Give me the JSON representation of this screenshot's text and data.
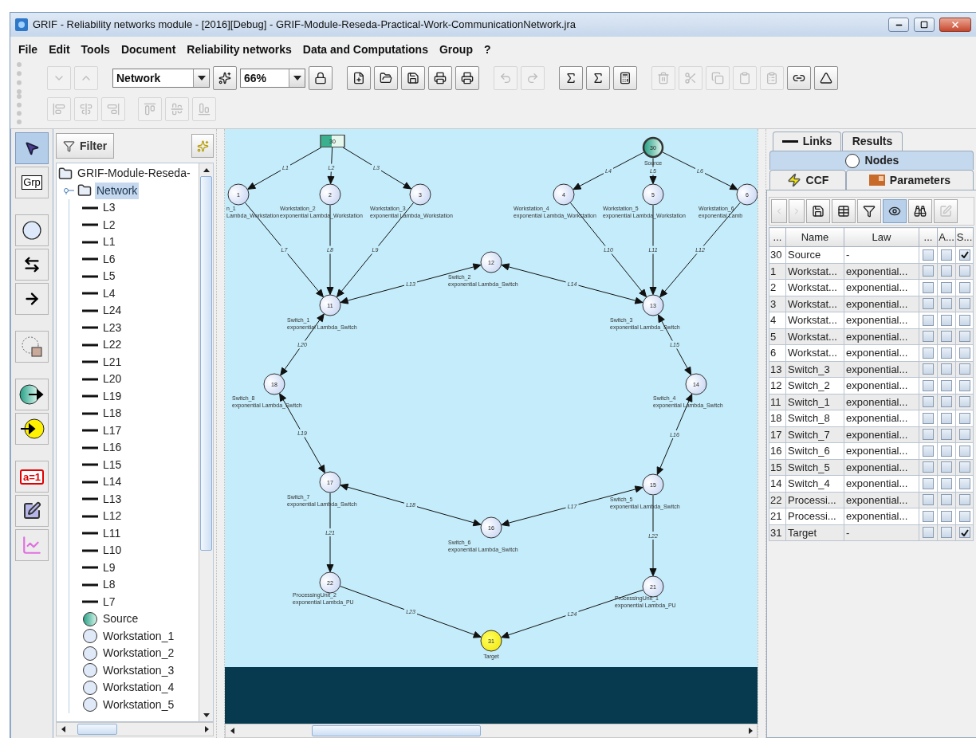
{
  "window": {
    "title": "GRIF - Reliability networks module - [2016][Debug] - GRIF-Module-Reseda-Practical-Work-CommunicationNetwork.jra"
  },
  "menu": [
    "File",
    "Edit",
    "Tools",
    "Document",
    "Reliability networks",
    "Data and Computations",
    "Group",
    "?"
  ],
  "toolbar": {
    "network_select": {
      "value": "Network"
    },
    "zoom_select": {
      "value": "66%"
    },
    "buttons": [
      {
        "disabled": true
      },
      {
        "disabled": true
      },
      {
        "disabled": false
      },
      {
        "disabled": false
      },
      {
        "disabled": false
      },
      {
        "disabled": false
      },
      {
        "disabled": false
      },
      {
        "disabled": false
      },
      {
        "disabled": false
      },
      {
        "disabled": true
      },
      {
        "disabled": true
      },
      {
        "disabled": false
      },
      {
        "disabled": false
      },
      {
        "disabled": false
      },
      {
        "disabled": true
      },
      {
        "disabled": true
      },
      {
        "disabled": true
      },
      {
        "disabled": true
      },
      {
        "disabled": true
      },
      {
        "disabled": false
      },
      {
        "disabled": false
      }
    ],
    "align_buttons": [
      {
        "disabled": true
      },
      {
        "disabled": true
      },
      {
        "disabled": true
      },
      {
        "disabled": true
      },
      {
        "disabled": true
      },
      {
        "disabled": true
      }
    ]
  },
  "tool_palette": [
    {
      "selected": true
    },
    {
      "label": "Grp",
      "selected": false
    },
    {
      "selected": false
    },
    {
      "selected": false
    },
    {
      "selected": false
    },
    {
      "selected": false
    },
    {
      "selected": false
    },
    {
      "selected": false
    },
    {
      "label": "a=1",
      "selected": false
    },
    {
      "selected": false
    },
    {
      "selected": false
    }
  ],
  "tree": {
    "filter_button": "Filter",
    "root": {
      "label": "GRIF-Module-Reseda-",
      "children": [
        {
          "label": "Network",
          "selected": true,
          "expanded": true,
          "children": [
            {
              "label": "L3",
              "kind": "link"
            },
            {
              "label": "L2",
              "kind": "link"
            },
            {
              "label": "L1",
              "kind": "link"
            },
            {
              "label": "L6",
              "kind": "link"
            },
            {
              "label": "L5",
              "kind": "link"
            },
            {
              "label": "L4",
              "kind": "link"
            },
            {
              "label": "L24",
              "kind": "link"
            },
            {
              "label": "L23",
              "kind": "link"
            },
            {
              "label": "L22",
              "kind": "link"
            },
            {
              "label": "L21",
              "kind": "link"
            },
            {
              "label": "L20",
              "kind": "link"
            },
            {
              "label": "L19",
              "kind": "link"
            },
            {
              "label": "L18",
              "kind": "link"
            },
            {
              "label": "L17",
              "kind": "link"
            },
            {
              "label": "L16",
              "kind": "link"
            },
            {
              "label": "L15",
              "kind": "link"
            },
            {
              "label": "L14",
              "kind": "link"
            },
            {
              "label": "L13",
              "kind": "link"
            },
            {
              "label": "L12",
              "kind": "link"
            },
            {
              "label": "L11",
              "kind": "link"
            },
            {
              "label": "L10",
              "kind": "link"
            },
            {
              "label": "L9",
              "kind": "link"
            },
            {
              "label": "L8",
              "kind": "link"
            },
            {
              "label": "L7",
              "kind": "link"
            },
            {
              "label": "Source",
              "kind": "source"
            },
            {
              "label": "Workstation_1",
              "kind": "node"
            },
            {
              "label": "Workstation_2",
              "kind": "node"
            },
            {
              "label": "Workstation_3",
              "kind": "node"
            },
            {
              "label": "Workstation_4",
              "kind": "node"
            },
            {
              "label": "Workstation_5",
              "kind": "node"
            }
          ]
        }
      ]
    }
  },
  "diagram": {
    "nodes": [
      {
        "id": "30",
        "kind": "box"
      },
      {
        "id": "30",
        "kind": "source",
        "name": "Source"
      },
      {
        "id": "1",
        "kind": "normal",
        "name": "n_1",
        "law": "Lambda_Workstation"
      },
      {
        "id": "2",
        "kind": "normal",
        "name": "Workstation_2",
        "law": "exponential Lambda_Workstation"
      },
      {
        "id": "3",
        "kind": "normal",
        "name": "Workstation_3",
        "law": "exponential Lambda_Workstation"
      },
      {
        "id": "4",
        "kind": "normal",
        "name": "Workstation_4",
        "law": "exponential Lambda_Workstation"
      },
      {
        "id": "5",
        "kind": "normal",
        "name": "Workstation_5",
        "law": "exponential Lambda_Workstation"
      },
      {
        "id": "6",
        "kind": "normal",
        "name": "Workstation_6",
        "law": "exponential Lamb"
      },
      {
        "id": "12",
        "kind": "normal",
        "name": "Switch_2",
        "law": "exponential Lambda_Switch"
      },
      {
        "id": "11",
        "kind": "normal",
        "name": "Switch_1",
        "law": "exponential Lambda_Switch"
      },
      {
        "id": "13",
        "kind": "normal",
        "name": "Switch_3",
        "law": "exponential Lambda_Switch"
      },
      {
        "id": "18",
        "kind": "normal",
        "name": "Switch_8",
        "law": "exponential Lambda_Switch"
      },
      {
        "id": "14",
        "kind": "normal",
        "name": "Switch_4",
        "law": "exponential Lambda_Switch"
      },
      {
        "id": "17",
        "kind": "normal",
        "name": "Switch_7",
        "law": "exponential Lambda_Switch"
      },
      {
        "id": "15",
        "kind": "normal",
        "name": "Switch_5",
        "law": "exponential Lambda_Switch"
      },
      {
        "id": "16",
        "kind": "normal",
        "name": "Switch_6",
        "law": "exponential Lambda_Switch"
      },
      {
        "id": "22",
        "kind": "normal",
        "name": "ProcessingUnit_2",
        "law": "exponential Lambda_PU"
      },
      {
        "id": "21",
        "kind": "normal",
        "name": "ProcessingUnit_1",
        "law": "exponential Lambda_PU"
      },
      {
        "id": "31",
        "kind": "target",
        "name": "Target"
      }
    ],
    "links": [
      {
        "label": "L1",
        "two_way": false
      },
      {
        "label": "L2",
        "two_way": false
      },
      {
        "label": "L3",
        "two_way": false
      },
      {
        "label": "L4",
        "two_way": false
      },
      {
        "label": "L5",
        "two_way": false
      },
      {
        "label": "L6",
        "two_way": false
      },
      {
        "label": "L7",
        "two_way": false
      },
      {
        "label": "L8",
        "two_way": false
      },
      {
        "label": "L9",
        "two_way": false
      },
      {
        "label": "L10",
        "two_way": false
      },
      {
        "label": "L11",
        "two_way": false
      },
      {
        "label": "L12",
        "two_way": false
      },
      {
        "label": "L13",
        "two_way": true
      },
      {
        "label": "L14",
        "two_way": true
      },
      {
        "label": "L15",
        "two_way": true
      },
      {
        "label": "L16",
        "two_way": true
      },
      {
        "label": "L17",
        "two_way": true
      },
      {
        "label": "L18",
        "two_way": true
      },
      {
        "label": "L19",
        "two_way": true
      },
      {
        "label": "L20",
        "two_way": true
      },
      {
        "label": "L21",
        "two_way": false
      },
      {
        "label": "L22",
        "two_way": false
      },
      {
        "label": "L23",
        "two_way": false
      },
      {
        "label": "L24",
        "two_way": false
      }
    ]
  },
  "side_tabs": [
    {
      "label": "Links",
      "selected": false
    },
    {
      "label": "Results",
      "selected": false
    },
    {
      "label": "Nodes",
      "selected": true
    },
    {
      "label": "CCF",
      "selected": false
    },
    {
      "label": "Parameters",
      "selected": false
    }
  ],
  "table_toolbar": [
    {
      "disabled": true,
      "selected": false
    },
    {
      "disabled": true,
      "selected": false
    },
    {
      "disabled": false,
      "selected": false
    },
    {
      "disabled": false,
      "selected": false
    },
    {
      "disabled": false,
      "selected": false
    },
    {
      "disabled": false,
      "selected": true
    },
    {
      "disabled": false,
      "selected": false
    },
    {
      "disabled": true,
      "selected": false
    }
  ],
  "nodes_table": {
    "columns": [
      "...",
      "Name",
      "Law",
      "...",
      "A...",
      "S..."
    ],
    "rows": [
      {
        "id": "30",
        "name": "Source",
        "law": "-",
        "checks": [
          {
            "checked": false
          },
          {
            "checked": false
          },
          {
            "checked": true
          }
        ]
      },
      {
        "id": "1",
        "name": "Workstat...",
        "law": "exponential...",
        "checks": [
          {
            "checked": false
          },
          {
            "checked": false
          },
          {
            "checked": false
          }
        ]
      },
      {
        "id": "2",
        "name": "Workstat...",
        "law": "exponential...",
        "checks": [
          {
            "checked": false
          },
          {
            "checked": false
          },
          {
            "checked": false
          }
        ]
      },
      {
        "id": "3",
        "name": "Workstat...",
        "law": "exponential...",
        "checks": [
          {
            "checked": false
          },
          {
            "checked": false
          },
          {
            "checked": false
          }
        ]
      },
      {
        "id": "4",
        "name": "Workstat...",
        "law": "exponential...",
        "checks": [
          {
            "checked": false
          },
          {
            "checked": false
          },
          {
            "checked": false
          }
        ]
      },
      {
        "id": "5",
        "name": "Workstat...",
        "law": "exponential...",
        "checks": [
          {
            "checked": false
          },
          {
            "checked": false
          },
          {
            "checked": false
          }
        ]
      },
      {
        "id": "6",
        "name": "Workstat...",
        "law": "exponential...",
        "checks": [
          {
            "checked": false
          },
          {
            "checked": false
          },
          {
            "checked": false
          }
        ]
      },
      {
        "id": "13",
        "name": "Switch_3",
        "law": "exponential...",
        "checks": [
          {
            "checked": false
          },
          {
            "checked": false
          },
          {
            "checked": false
          }
        ]
      },
      {
        "id": "12",
        "name": "Switch_2",
        "law": "exponential...",
        "checks": [
          {
            "checked": false
          },
          {
            "checked": false
          },
          {
            "checked": false
          }
        ]
      },
      {
        "id": "11",
        "name": "Switch_1",
        "law": "exponential...",
        "checks": [
          {
            "checked": false
          },
          {
            "checked": false
          },
          {
            "checked": false
          }
        ]
      },
      {
        "id": "18",
        "name": "Switch_8",
        "law": "exponential...",
        "checks": [
          {
            "checked": false
          },
          {
            "checked": false
          },
          {
            "checked": false
          }
        ]
      },
      {
        "id": "17",
        "name": "Switch_7",
        "law": "exponential...",
        "checks": [
          {
            "checked": false
          },
          {
            "checked": false
          },
          {
            "checked": false
          }
        ]
      },
      {
        "id": "16",
        "name": "Switch_6",
        "law": "exponential...",
        "checks": [
          {
            "checked": false
          },
          {
            "checked": false
          },
          {
            "checked": false
          }
        ]
      },
      {
        "id": "15",
        "name": "Switch_5",
        "law": "exponential...",
        "checks": [
          {
            "checked": false
          },
          {
            "checked": false
          },
          {
            "checked": false
          }
        ]
      },
      {
        "id": "14",
        "name": "Switch_4",
        "law": "exponential...",
        "checks": [
          {
            "checked": false
          },
          {
            "checked": false
          },
          {
            "checked": false
          }
        ]
      },
      {
        "id": "22",
        "name": "Processi...",
        "law": "exponential...",
        "checks": [
          {
            "checked": false
          },
          {
            "checked": false
          },
          {
            "checked": false
          }
        ]
      },
      {
        "id": "21",
        "name": "Processi...",
        "law": "exponential...",
        "checks": [
          {
            "checked": false
          },
          {
            "checked": false
          },
          {
            "checked": false
          }
        ]
      },
      {
        "id": "31",
        "name": "Target",
        "law": "-",
        "checks": [
          {
            "checked": false
          },
          {
            "checked": false
          },
          {
            "checked": true
          }
        ]
      }
    ]
  }
}
